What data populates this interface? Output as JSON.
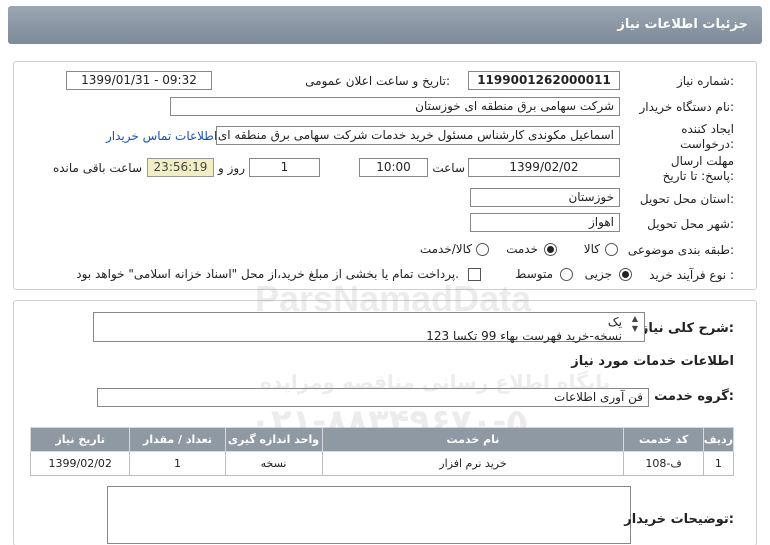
{
  "header": {
    "title": "جزئیات اطلاعات نیاز"
  },
  "need_info": {
    "need_number_label": "شماره نیاز:",
    "need_number": "1199001262000011",
    "announce_label": "تاریخ و ساعت اعلان عمومی:",
    "announce_value": "1399/01/31 - 09:32",
    "buyer_label": "نام دستگاه خریدار:",
    "buyer_value": "شرکت سهامی برق منطقه ای خوزستان",
    "creator_label": "ایجاد کننده درخواست:",
    "creator_value": "اسماعیل مکوندی کارشناس مسئول خرید خدمات شرکت سهامی برق منطقه ای",
    "contact_link": "اطلاعات تماس خریدار",
    "deadline_label": "مهلت ارسال پاسخ: تا تاریخ:",
    "deadline_date": "1399/02/02",
    "time_label": "ساعت",
    "deadline_time": "10:00",
    "days_value": "1",
    "days_label": "روز و",
    "remaining_time": "23:56:19",
    "remaining_label": "ساعت باقی مانده",
    "province_label": "استان محل تحویل:",
    "province_value": "خوزستان",
    "city_label": "شهر محل تحویل:",
    "city_value": "اهواز",
    "category_label": "طبقه بندی موضوعی:",
    "category_options": [
      "کالا",
      "خدمت",
      "کالا/خدمت"
    ],
    "category_selected": "خدمت",
    "process_label": "نوع فرآیند خرید :",
    "process_options": [
      "جزیی",
      "متوسط"
    ],
    "process_selected": "جزیی",
    "payment_note": "پرداخت تمام یا بخشی از مبلغ خرید،از محل \"اسناد خزانه اسلامی\" خواهد بود."
  },
  "description": {
    "label": "شرح کلی نیاز:",
    "line1": "یک",
    "line2": "نسخه-خرید فهرست بهاء 99 تکسا 123"
  },
  "services": {
    "section_title": "اطلاعات خدمات مورد نیاز",
    "group_label": "گروه خدمت:",
    "group_value": "فن آوری اطلاعات",
    "columns": [
      "ردیف",
      "کد خدمت",
      "نام خدمت",
      "واحد اندازه گیری",
      "تعداد / مقدار",
      "تاریخ نیاز"
    ],
    "rows": [
      {
        "row": "1",
        "code": "ف-108",
        "name": "خرید نرم افزار",
        "unit": "نسخه",
        "qty": "1",
        "date": "1399/02/02"
      }
    ]
  },
  "buyer_notes": {
    "label": "توضیحات خریدار:"
  },
  "watermark": {
    "brand": "ParsNamadData",
    "line1": "پایگاه اطلاع رسانی مناقصه ومزایده",
    "phone": "۰۲۱-۸۸۳۴۹۶۷۰-۵"
  },
  "colors": {
    "header_bg": "#8a96a2",
    "table_header_bg": "#8f99a4",
    "link": "#1a4fb0",
    "timer_bg": "#f1eec4"
  }
}
